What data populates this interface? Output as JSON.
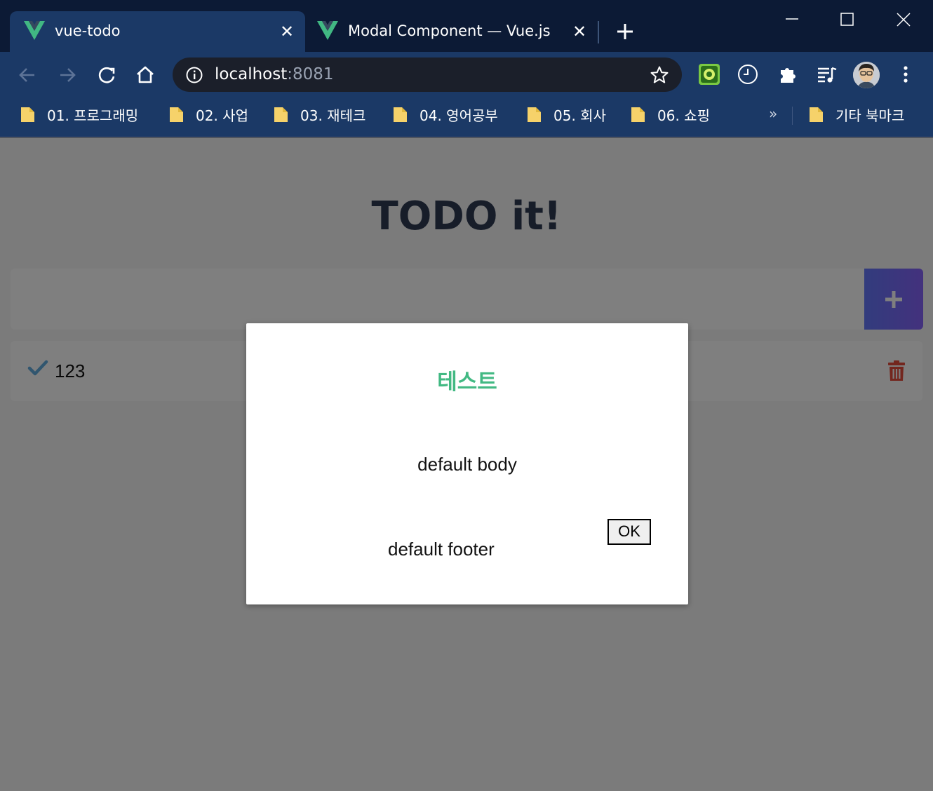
{
  "tabs": [
    {
      "title": "vue-todo",
      "active": true,
      "icon": "vue-logo-icon"
    },
    {
      "title": "Modal Component — Vue.js",
      "active": false,
      "icon": "vue-logo-icon"
    }
  ],
  "toolbar": {
    "url_host": "localhost",
    "url_port": ":8081"
  },
  "bookmarks": {
    "items": [
      {
        "label": "01. 프로그래밍"
      },
      {
        "label": "02. 사업"
      },
      {
        "label": "03. 재테크"
      },
      {
        "label": "04. 영어공부"
      },
      {
        "label": "05. 회사"
      },
      {
        "label": "06. 쇼핑"
      }
    ],
    "more": "»",
    "other": "기타 북마크"
  },
  "app": {
    "title": "TODO it!",
    "input_placeholder": "",
    "todos": [
      {
        "text": "123",
        "completed": false
      }
    ]
  },
  "modal": {
    "title": "테스트",
    "body": "default body",
    "footer": "default footer",
    "ok_label": "OK"
  },
  "colors": {
    "accent_green": "#42b983",
    "delete_red": "#e74c3c",
    "check_blue": "#62acde"
  }
}
